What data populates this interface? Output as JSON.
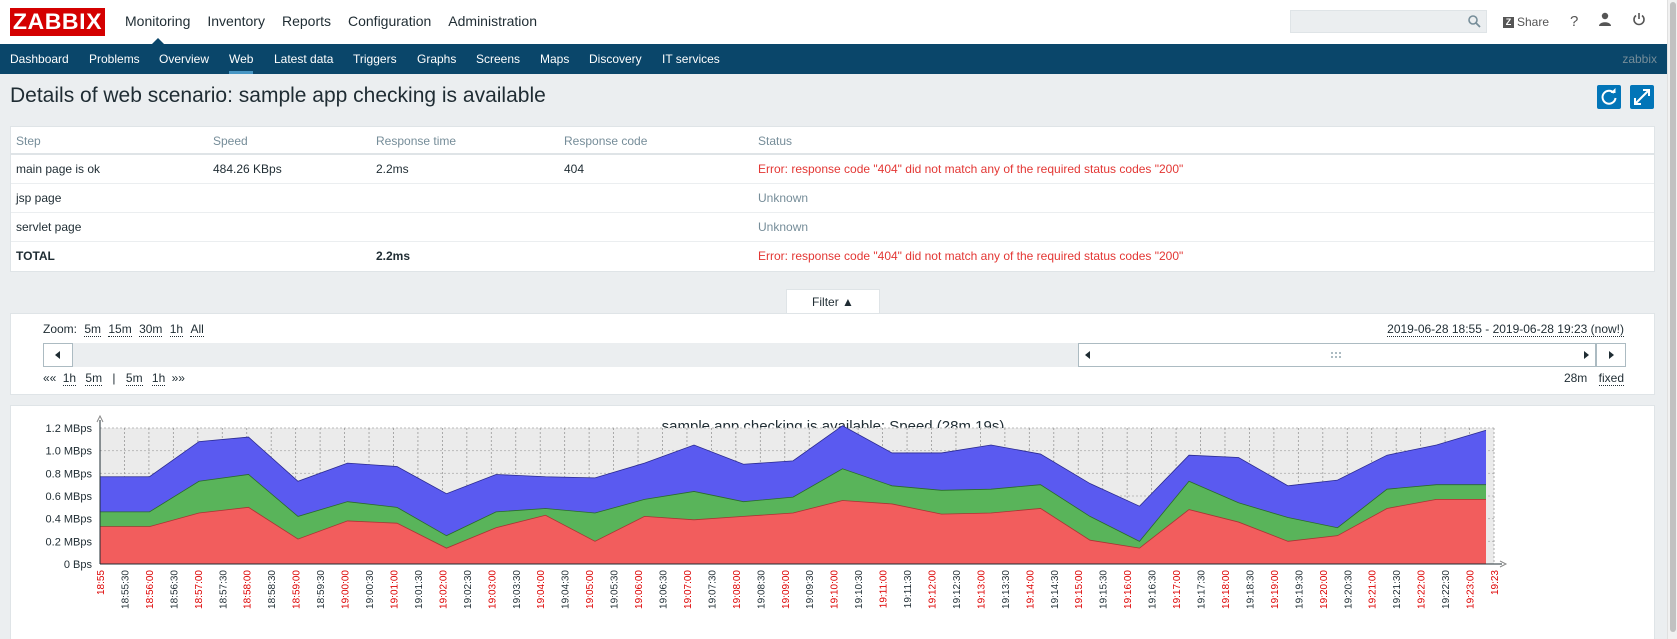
{
  "header": {
    "logo": "ZABBIX",
    "menu": [
      {
        "label": "Monitoring",
        "selected": true
      },
      {
        "label": "Inventory"
      },
      {
        "label": "Reports"
      },
      {
        "label": "Configuration"
      },
      {
        "label": "Administration"
      }
    ],
    "search_value": "",
    "share_label": "Share",
    "help_label": "?"
  },
  "subnav": {
    "items": [
      "Dashboard",
      "Problems",
      "Overview",
      "Web",
      "Latest data",
      "Triggers",
      "Graphs",
      "Screens",
      "Maps",
      "Discovery",
      "IT services"
    ],
    "active": "Web",
    "server_name": "zabbix"
  },
  "page": {
    "title": "Details of web scenario: sample app checking is available"
  },
  "table": {
    "columns": [
      "Step",
      "Speed",
      "Response time",
      "Response code",
      "Status"
    ],
    "rows": [
      {
        "step": "main page is ok",
        "speed": "484.26 KBps",
        "response_time": "2.2ms",
        "response_code": "404",
        "status": "Error: response code \"404\" did not match any of the required status codes \"200\""
      },
      {
        "step": "jsp page",
        "speed": "",
        "response_time": "",
        "response_code": "",
        "status": "Unknown"
      },
      {
        "step": "servlet page",
        "speed": "",
        "response_time": "",
        "response_code": "",
        "status": "Unknown"
      }
    ],
    "total": {
      "step": "TOTAL",
      "response_time": "2.2ms",
      "status": "Error: response code \"404\" did not match any of the required status codes \"200\""
    }
  },
  "filter": {
    "tab_label": "Filter ▲",
    "zoom_label": "Zoom:",
    "zoom_options": [
      "5m",
      "15m",
      "30m",
      "1h",
      "All"
    ],
    "date_from": "2019-06-28 18:55",
    "date_separator": " - ",
    "date_to": "2019-06-28 19:23",
    "date_now": "(now!)",
    "nav_back_all": "««",
    "nav_back": [
      "1h",
      "5m"
    ],
    "nav_sep": "|",
    "nav_fwd": [
      "5m",
      "1h"
    ],
    "nav_fwd_all": "»»",
    "period": "28m",
    "fixed_label": "fixed"
  },
  "chart_data": {
    "type": "area",
    "title": "sample app checking is available: Speed (28m 19s)",
    "y_ticks": [
      "1.2 MBps",
      "1.0 MBps",
      "0.8 MBps",
      "0.6 MBps",
      "0.4 MBps",
      "0.2 MBps",
      "0 Bps"
    ],
    "ylim": [
      0,
      1.2
    ],
    "y_unit": "MBps",
    "x_ticks": [
      "18:55",
      "18:55:30",
      "18:56:00",
      "18:56:30",
      "18:57:00",
      "18:57:30",
      "18:58:00",
      "18:58:30",
      "18:59:00",
      "18:59:30",
      "19:00:00",
      "19:00:30",
      "19:01:00",
      "19:01:30",
      "19:02:00",
      "19:02:30",
      "19:03:00",
      "19:03:30",
      "19:04:00",
      "19:04:30",
      "19:05:00",
      "19:05:30",
      "19:06:00",
      "19:06:30",
      "19:07:00",
      "19:07:30",
      "19:08:00",
      "19:08:30",
      "19:09:00",
      "19:09:30",
      "19:10:00",
      "19:10:30",
      "19:11:00",
      "19:11:30",
      "19:12:00",
      "19:12:30",
      "19:13:00",
      "19:13:30",
      "19:14:00",
      "19:14:30",
      "19:15:00",
      "19:15:30",
      "19:16:00",
      "19:16:30",
      "19:17:00",
      "19:17:30",
      "19:18:00",
      "19:18:30",
      "19:19:00",
      "19:19:30",
      "19:20:00",
      "19:20:30",
      "19:21:00",
      "19:21:30",
      "19:22:00",
      "19:22:30",
      "19:23:00",
      "19:23"
    ],
    "x_tick_colors_red_every_minute": true,
    "stacked": true,
    "series": [
      {
        "color": "#f25d5d",
        "values": [
          0.33,
          0.33,
          0.45,
          0.5,
          0.22,
          0.38,
          0.36,
          0.14,
          0.32,
          0.43,
          0.2,
          0.42,
          0.39,
          0.42,
          0.45,
          0.56,
          0.53,
          0.44,
          0.45,
          0.49,
          0.21,
          0.14,
          0.48,
          0.37,
          0.2,
          0.25,
          0.49,
          0.57,
          0.57
        ]
      },
      {
        "color": "#59b45a",
        "values": [
          0.13,
          0.13,
          0.28,
          0.29,
          0.2,
          0.17,
          0.14,
          0.11,
          0.14,
          0.06,
          0.25,
          0.15,
          0.25,
          0.13,
          0.14,
          0.28,
          0.16,
          0.21,
          0.21,
          0.21,
          0.21,
          0.06,
          0.25,
          0.17,
          0.21,
          0.07,
          0.17,
          0.13,
          0.13
        ]
      },
      {
        "color": "#5a5af0",
        "values": [
          0.31,
          0.31,
          0.35,
          0.33,
          0.31,
          0.34,
          0.36,
          0.37,
          0.33,
          0.28,
          0.31,
          0.32,
          0.41,
          0.33,
          0.32,
          0.38,
          0.29,
          0.33,
          0.39,
          0.27,
          0.29,
          0.31,
          0.23,
          0.4,
          0.28,
          0.42,
          0.3,
          0.35,
          0.48
        ]
      }
    ]
  }
}
